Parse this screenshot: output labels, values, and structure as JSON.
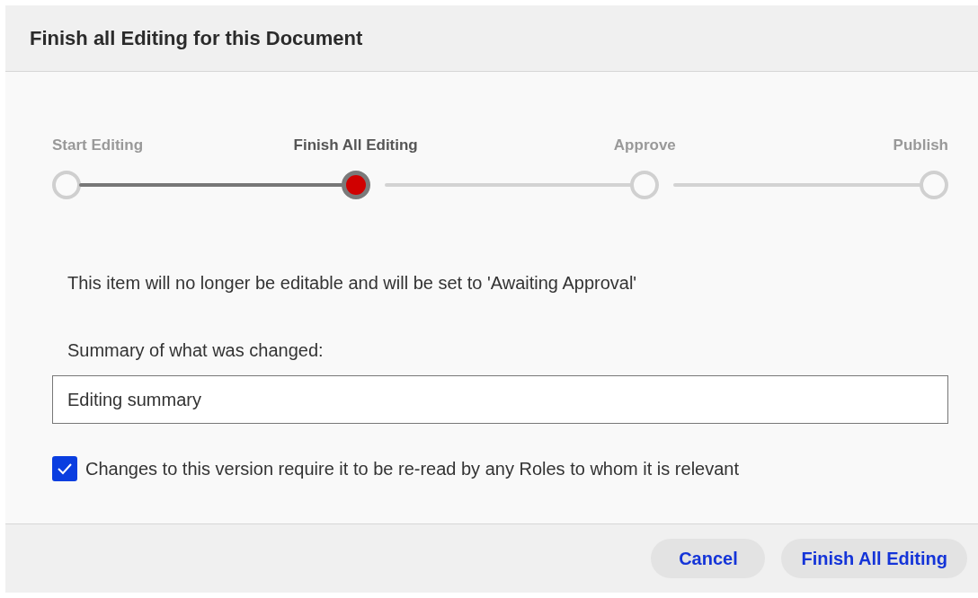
{
  "dialog": {
    "title": "Finish all Editing for this Document"
  },
  "steps": [
    {
      "label": "Start Editing",
      "completed": true,
      "selected": false
    },
    {
      "label": "Finish All Editing",
      "completed": false,
      "selected": true
    },
    {
      "label": "Approve",
      "completed": false,
      "selected": false
    },
    {
      "label": "Publish",
      "completed": false,
      "selected": false
    }
  ],
  "message": "This item will no longer be editable and will be set to 'Awaiting Approval'",
  "summary_field": {
    "label": "Summary of what was changed:",
    "placeholder": "Editing summary"
  },
  "reread_checkbox": {
    "label": "Changes to this version require it to be re-read by any Roles to whom it is relevant",
    "checked": true
  },
  "buttons": [
    "Cancel",
    "Finish All Editing"
  ]
}
